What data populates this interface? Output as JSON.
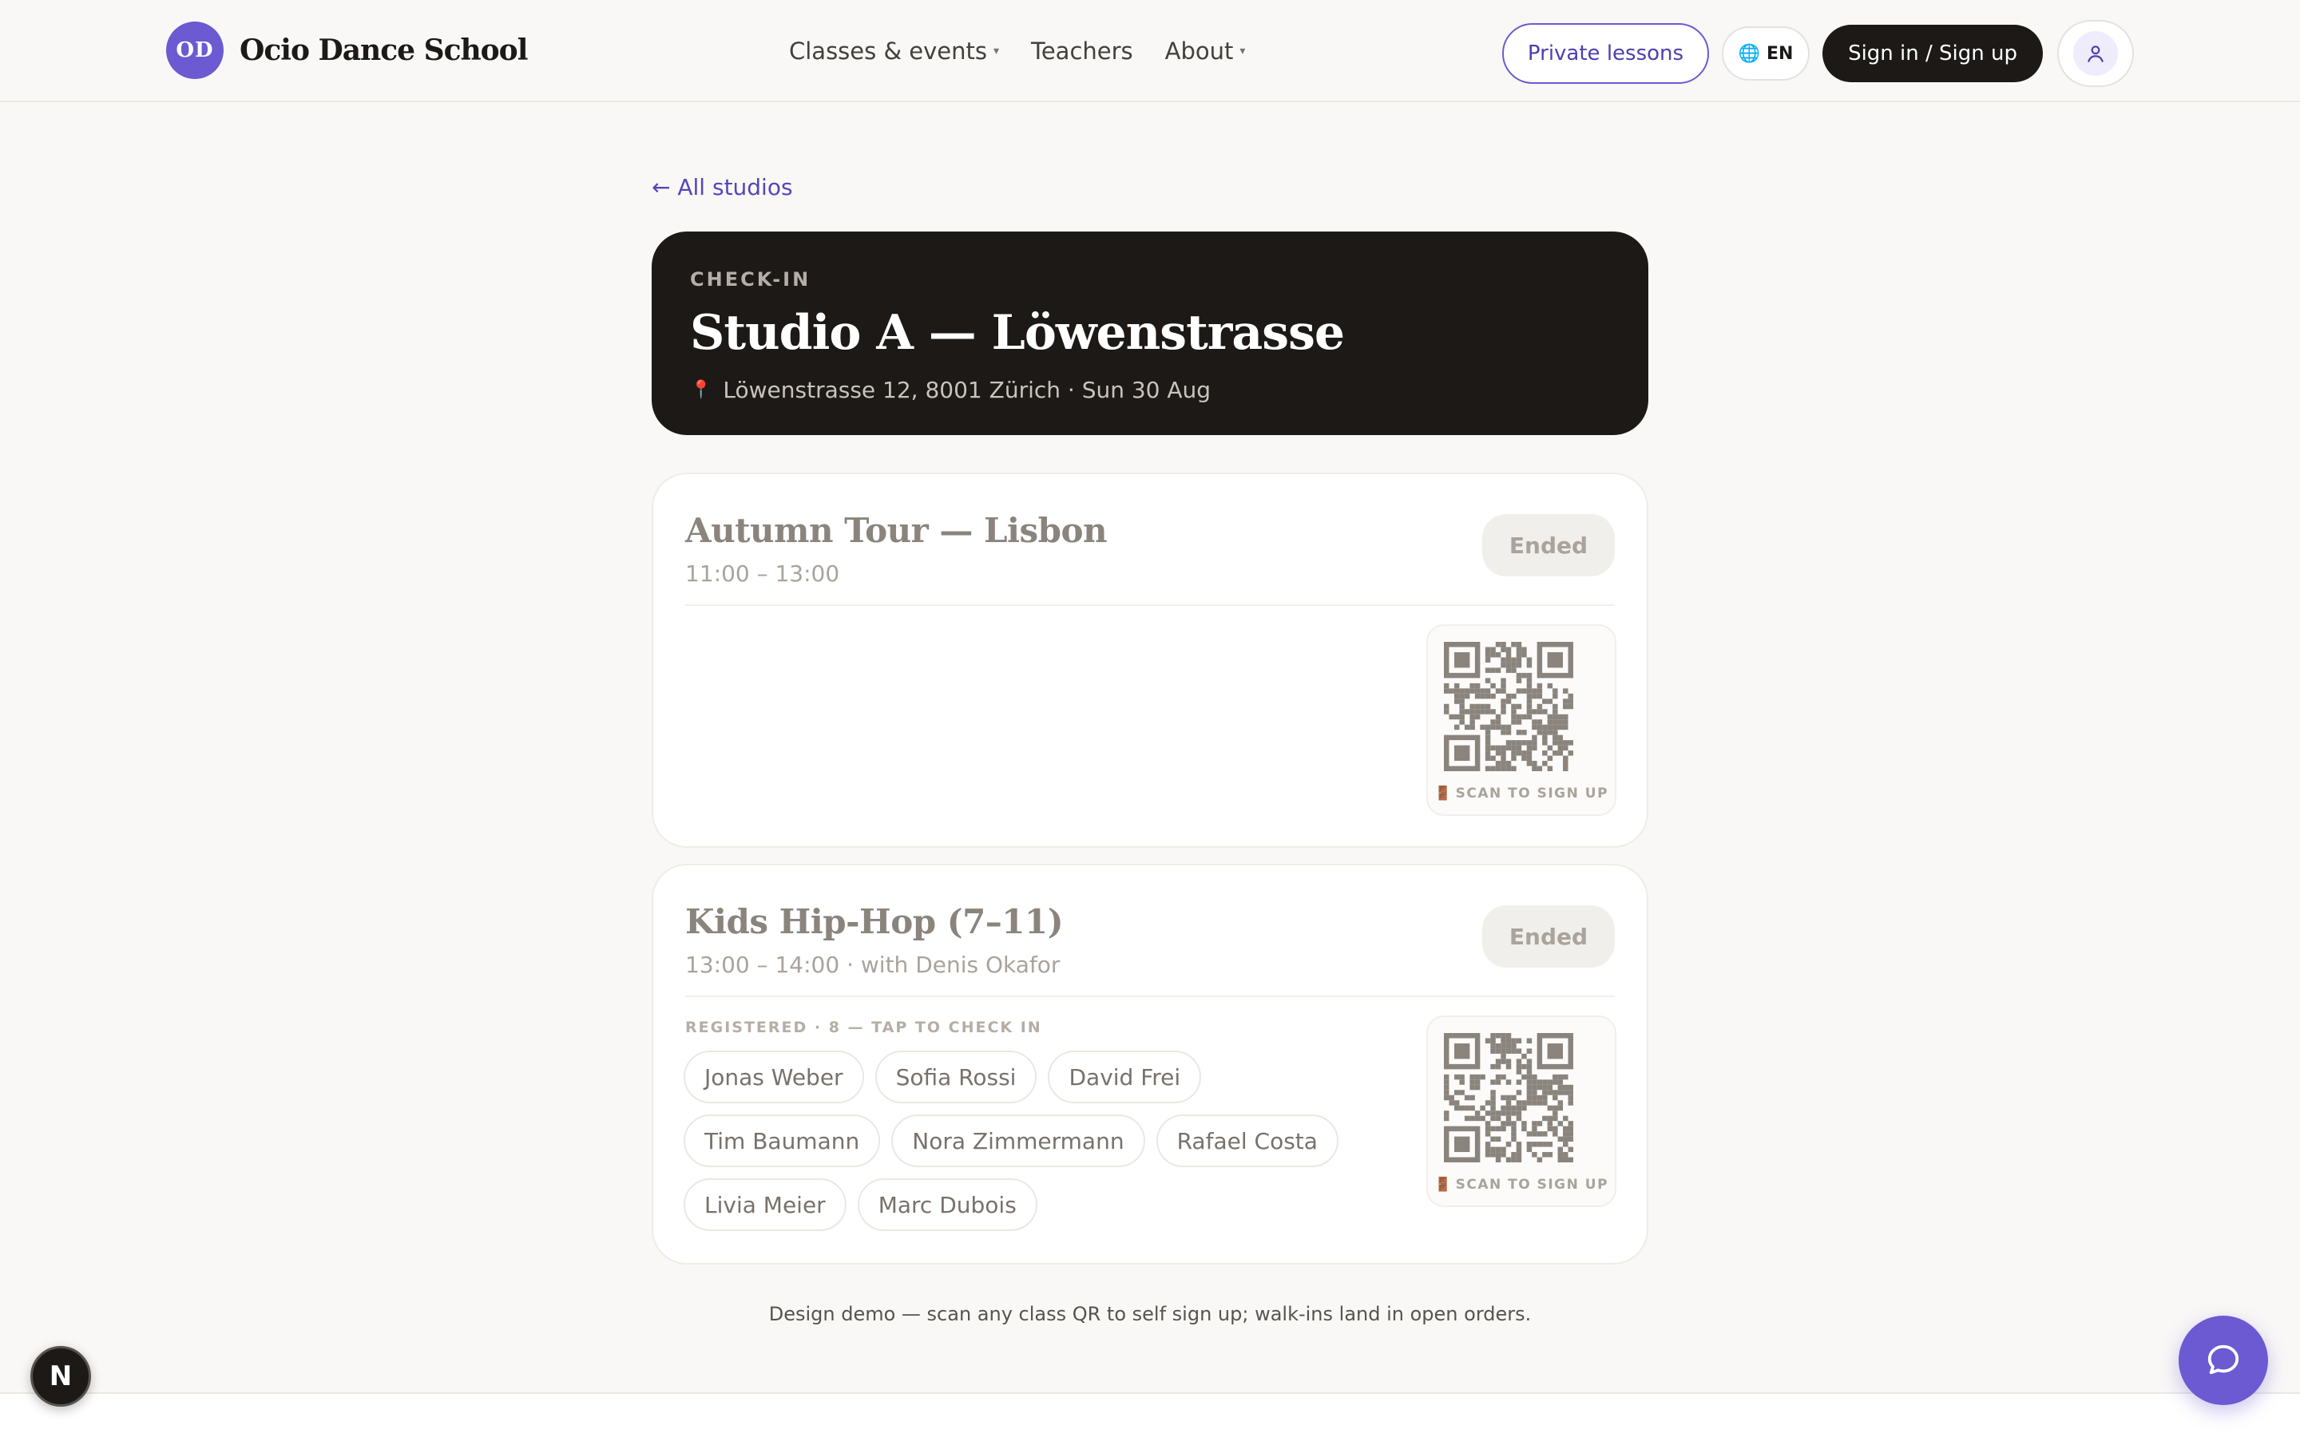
{
  "header": {
    "brand_initials": "OD",
    "brand_name": "Ocio Dance School",
    "nav": [
      {
        "label": "Classes & events",
        "has_dropdown": true
      },
      {
        "label": "Teachers",
        "has_dropdown": false
      },
      {
        "label": "About",
        "has_dropdown": true
      }
    ],
    "private_lessons_label": "Private lessons",
    "language_label": "EN",
    "signin_label": "Sign in / Sign up"
  },
  "back_link": "← All studios",
  "hero": {
    "eyebrow": "CHECK-IN",
    "title": "Studio A — Löwenstrasse",
    "subtitle": "Löwenstrasse 12, 8001 Zürich · Sun 30 Aug"
  },
  "classes": [
    {
      "title": "Autumn Tour — Lisbon",
      "time": "11:00 – 13:00",
      "status": "Ended",
      "qr_caption": "SCAN TO SIGN UP"
    },
    {
      "title": "Kids Hip-Hop (7–11)",
      "time": "13:00 – 14:00 · with Denis Okafor",
      "status": "Ended",
      "qr_caption": "SCAN TO SIGN UP",
      "registered_label": "REGISTERED · 8 — TAP TO CHECK IN",
      "attendees": [
        "Jonas Weber",
        "Sofia Rossi",
        "David Frei",
        "Tim Baumann",
        "Nora Zimmermann",
        "Rafael Costa",
        "Livia Meier",
        "Marc Dubois"
      ]
    }
  ],
  "footer_note": "Design demo — scan any class QR to self sign up; walk-ins land in open orders.",
  "dev_badge": "N",
  "colors": {
    "accent": "#6b5ad1",
    "dark": "#1c1917",
    "background": "#f9f8f6"
  }
}
